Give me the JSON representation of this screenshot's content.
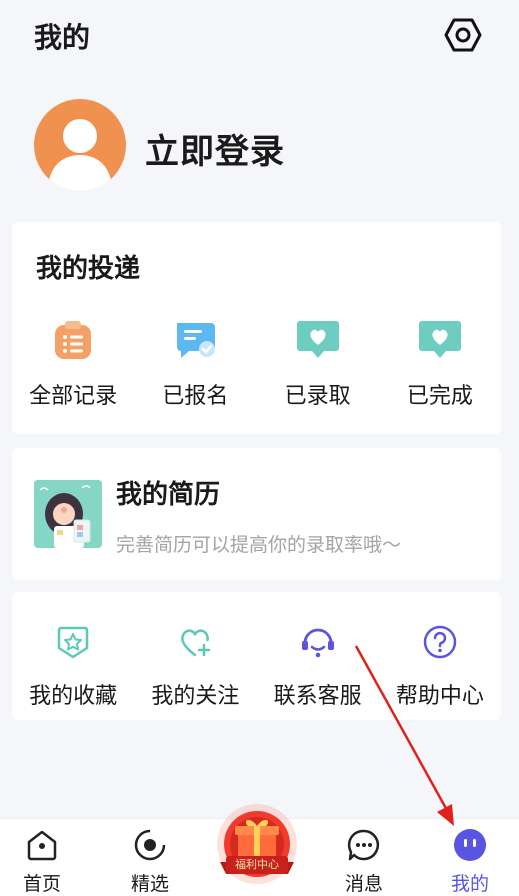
{
  "header": {
    "title": "我的",
    "settings_icon": "settings-hex-icon"
  },
  "profile": {
    "login_label": "立即登录",
    "avatar_color": "#f0924f"
  },
  "delivery": {
    "title": "我的投递",
    "items": [
      {
        "label": "全部记录",
        "icon": "clipboard-list-icon",
        "color": "#f5a066"
      },
      {
        "label": "已报名",
        "icon": "message-check-icon",
        "color": "#5cb8f0"
      },
      {
        "label": "已录取",
        "icon": "heart-chat-icon",
        "color": "#6ccdc0"
      },
      {
        "label": "已完成",
        "icon": "heart-chat-icon",
        "color": "#6ccdc0"
      }
    ]
  },
  "resume": {
    "title": "我的简历",
    "subtitle": "完善简历可以提高你的录取率哦～"
  },
  "services": {
    "items": [
      {
        "label": "我的收藏",
        "icon": "star-bookmark-icon",
        "color": "#5cc9b8"
      },
      {
        "label": "我的关注",
        "icon": "heart-plus-icon",
        "color": "#5cc9b8"
      },
      {
        "label": "联系客服",
        "icon": "headset-icon",
        "color": "#5a55e0"
      },
      {
        "label": "帮助中心",
        "icon": "question-circle-icon",
        "color": "#5a55e0"
      }
    ]
  },
  "tabbar": {
    "items": [
      {
        "label": "首页",
        "icon": "home-icon"
      },
      {
        "label": "精选",
        "icon": "featured-icon"
      },
      {
        "label": "消息",
        "icon": "message-icon"
      },
      {
        "label": "我的",
        "icon": "mine-icon",
        "active": true
      }
    ],
    "gift_label": "福利中心",
    "active_color": "#5a55e0"
  }
}
